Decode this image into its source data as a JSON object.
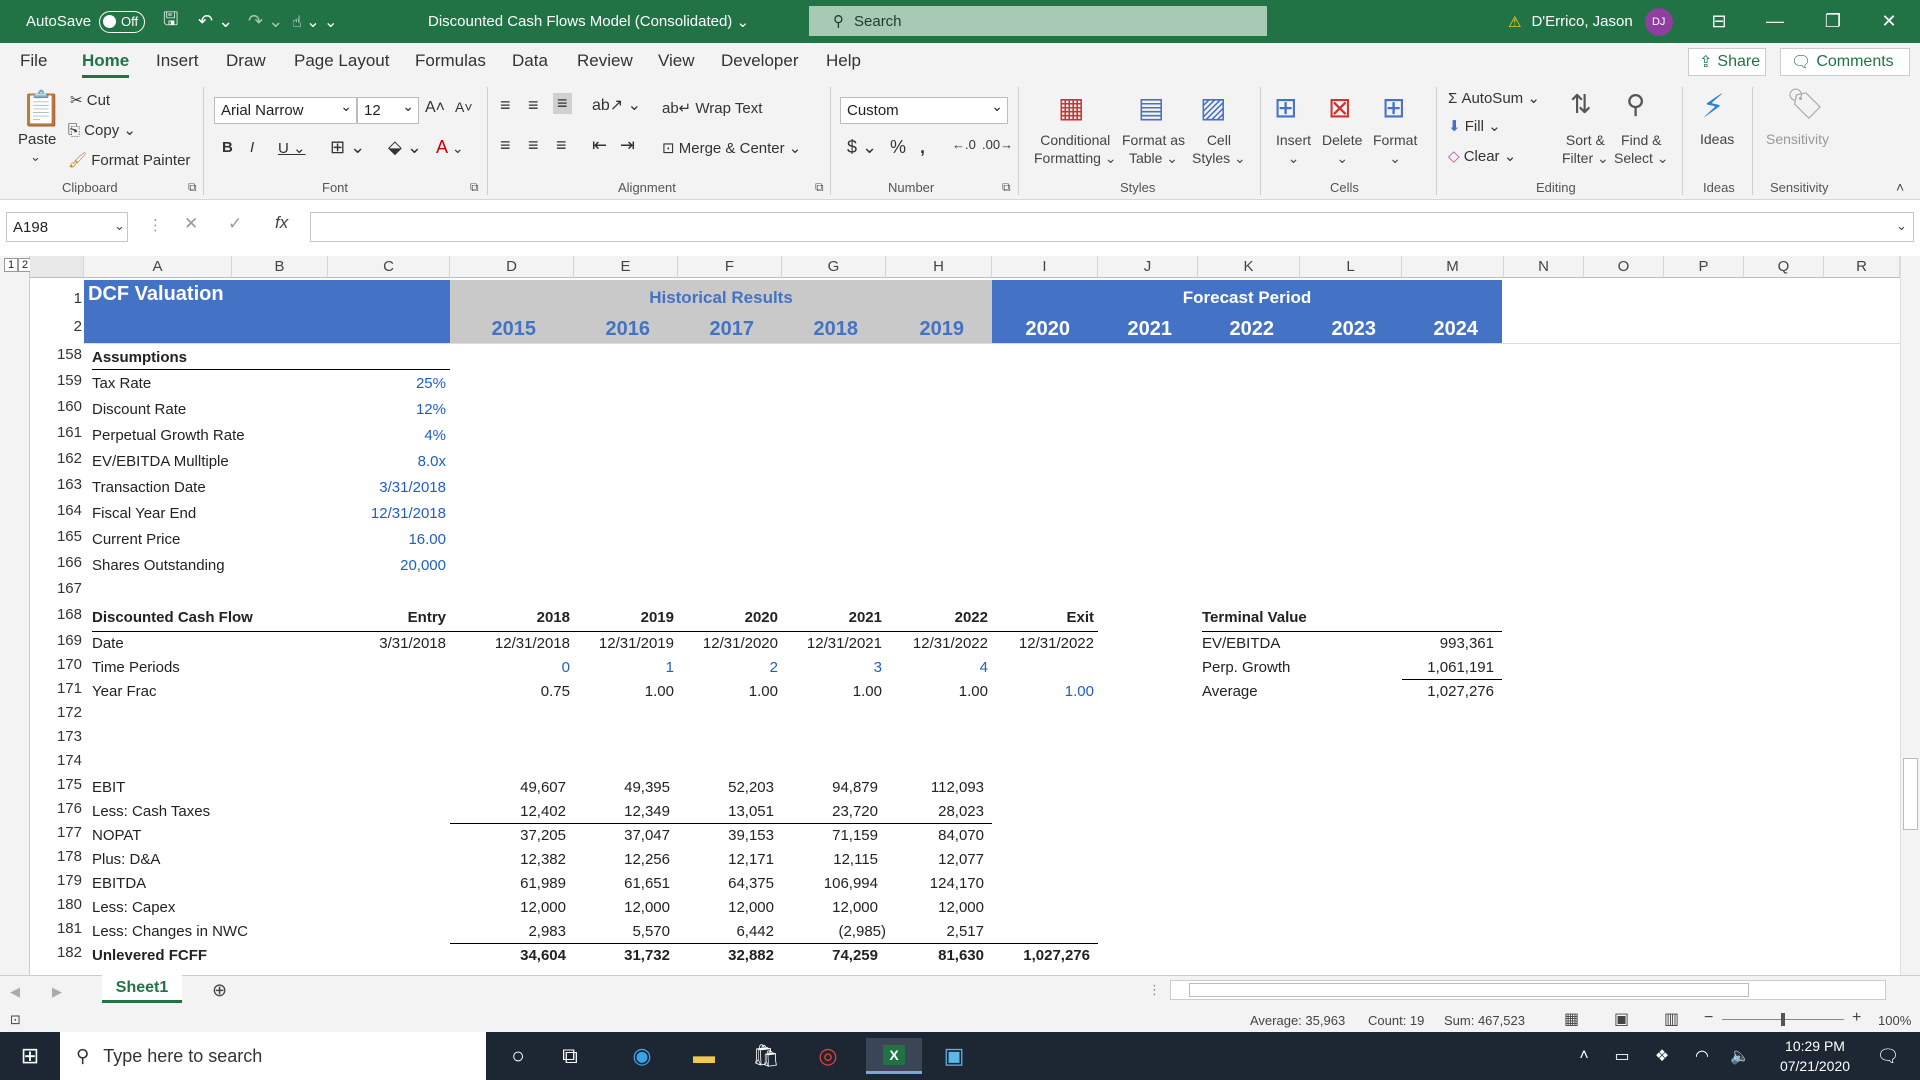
{
  "titlebar": {
    "autosave": "AutoSave",
    "autosave_state": "Off",
    "doc_title": "Discounted Cash Flows Model (Consolidated)",
    "search": "Search",
    "user": "D'Errico, Jason",
    "initials": "DJ"
  },
  "menu": [
    "File",
    "Home",
    "Insert",
    "Draw",
    "Page Layout",
    "Formulas",
    "Data",
    "Review",
    "View",
    "Developer",
    "Help"
  ],
  "share": "Share",
  "comments": "Comments",
  "ribbon": {
    "clipboard": {
      "paste": "Paste",
      "cut": "Cut",
      "copy": "Copy",
      "format_painter": "Format Painter",
      "label": "Clipboard"
    },
    "font": {
      "name": "Arial Narrow",
      "size": "12",
      "label": "Font"
    },
    "alignment": {
      "wrap": "Wrap Text",
      "merge": "Merge & Center",
      "label": "Alignment"
    },
    "number": {
      "format": "Custom",
      "label": "Number"
    },
    "styles": {
      "cond1": "Conditional",
      "cond2": "Formatting",
      "fmt1": "Format as",
      "fmt2": "Table",
      "cell1": "Cell",
      "cell2": "Styles",
      "label": "Styles"
    },
    "cells": {
      "insert": "Insert",
      "delete": "Delete",
      "format": "Format",
      "label": "Cells"
    },
    "editing": {
      "autosum": "AutoSum",
      "fill": "Fill",
      "clear": "Clear",
      "sort1": "Sort &",
      "sort2": "Filter",
      "find1": "Find &",
      "find2": "Select",
      "label": "Editing"
    },
    "ideas": {
      "btn": "Ideas",
      "label": "Ideas"
    },
    "sensitivity": {
      "btn": "Sensitivity",
      "label": "Sensitivity"
    }
  },
  "namebox": "A198",
  "columns": [
    "A",
    "B",
    "C",
    "D",
    "E",
    "F",
    "G",
    "H",
    "I",
    "J",
    "K",
    "L",
    "M",
    "N",
    "O",
    "P",
    "Q",
    "R"
  ],
  "header": {
    "title": "DCF Valuation",
    "historical": "Historical Results",
    "forecast": "Forecast Period",
    "years": [
      "2015",
      "2016",
      "2017",
      "2018",
      "2019",
      "2020",
      "2021",
      "2022",
      "2023",
      "2024"
    ]
  },
  "rows": [
    "1",
    "2",
    "158",
    "159",
    "160",
    "161",
    "162",
    "163",
    "164",
    "165",
    "166",
    "167",
    "168",
    "169",
    "170",
    "171",
    "172",
    "173",
    "174",
    "175",
    "176",
    "177",
    "178",
    "179",
    "180",
    "181",
    "182"
  ],
  "assumptions": {
    "title": "Assumptions",
    "items": [
      [
        "Tax Rate",
        "25%"
      ],
      [
        "Discount Rate",
        "12%"
      ],
      [
        "Perpetual Growth Rate",
        "4%"
      ],
      [
        "EV/EBITDA Mulltiple",
        "8.0x"
      ],
      [
        "Transaction Date",
        "3/31/2018"
      ],
      [
        "Fiscal Year End",
        "12/31/2018"
      ],
      [
        "Current Price",
        "16.00"
      ],
      [
        "Shares Outstanding",
        "20,000"
      ]
    ]
  },
  "dcf": {
    "title": "Discounted Cash Flow",
    "cols": [
      "Entry",
      "2018",
      "2019",
      "2020",
      "2021",
      "2022",
      "Exit"
    ],
    "date": [
      "Date",
      "3/31/2018",
      "12/31/2018",
      "12/31/2019",
      "12/31/2020",
      "12/31/2021",
      "12/31/2022",
      "12/31/2022"
    ],
    "periods": [
      "Time Periods",
      "",
      "0",
      "1",
      "2",
      "3",
      "4",
      ""
    ],
    "yearfrac": [
      "Year Frac",
      "",
      "0.75",
      "1.00",
      "1.00",
      "1.00",
      "1.00",
      "1.00"
    ],
    "lines": [
      [
        "EBIT",
        "49,607",
        "49,395",
        "52,203",
        "94,879",
        "112,093",
        ""
      ],
      [
        "Less: Cash Taxes",
        "12,402",
        "12,349",
        "13,051",
        "23,720",
        "28,023",
        ""
      ],
      [
        "NOPAT",
        "37,205",
        "37,047",
        "39,153",
        "71,159",
        "84,070",
        ""
      ],
      [
        "Plus: D&A",
        "12,382",
        "12,256",
        "12,171",
        "12,115",
        "12,077",
        ""
      ],
      [
        "EBITDA",
        "61,989",
        "61,651",
        "64,375",
        "106,994",
        "124,170",
        ""
      ],
      [
        "Less: Capex",
        "12,000",
        "12,000",
        "12,000",
        "12,000",
        "12,000",
        ""
      ],
      [
        "Less: Changes in NWC",
        "2,983",
        "5,570",
        "6,442",
        "(2,985)",
        "2,517",
        ""
      ],
      [
        "Unlevered FCFF",
        "34,604",
        "31,732",
        "32,882",
        "74,259",
        "81,630",
        "1,027,276"
      ]
    ]
  },
  "terminal": {
    "title": "Terminal Value",
    "items": [
      [
        "EV/EBITDA",
        "993,361"
      ],
      [
        "Perp. Growth",
        "1,061,191"
      ],
      [
        "Average",
        "1,027,276"
      ]
    ]
  },
  "sheet_tab": "Sheet1",
  "status": {
    "average": "Average: 35,963",
    "count": "Count: 19",
    "sum": "Sum: 467,523",
    "zoom": "100%"
  },
  "taskbar": {
    "search": "Type here to search",
    "time": "10:29 PM",
    "date": "07/21/2020"
  },
  "colors": {
    "excel_green": "#217346",
    "header_blue": "#4472c4",
    "header_gray": "#c9c9c9",
    "input_blue": "#1f5fbf"
  }
}
